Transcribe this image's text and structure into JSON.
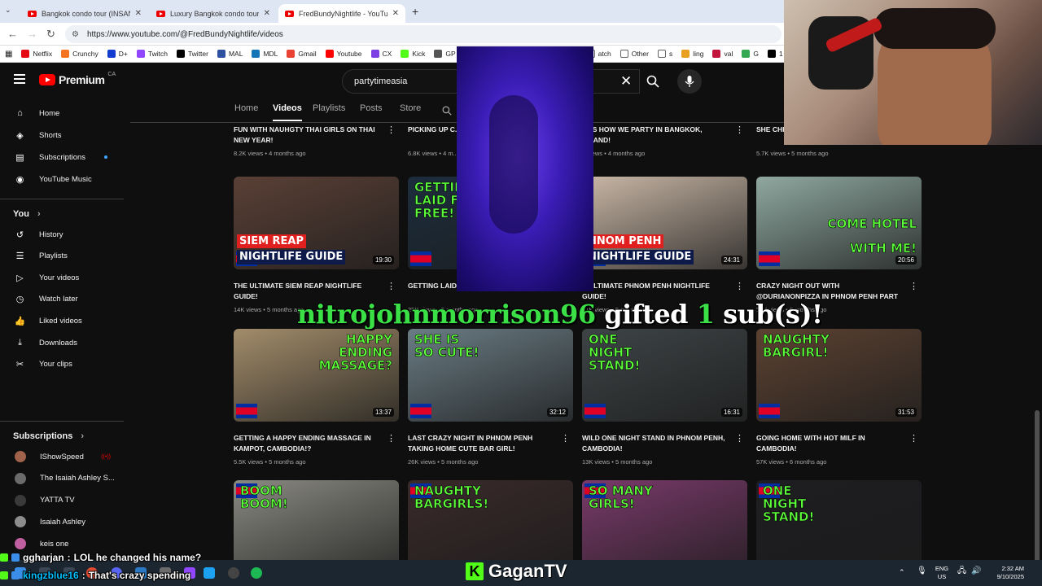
{
  "browser": {
    "tabs": [
      {
        "title": "Bangkok condo tour (INSANE v"
      },
      {
        "title": "Luxury Bangkok condo tour $5("
      },
      {
        "title": "FredBundyNightlife - YouTube"
      }
    ],
    "url": "https://www.youtube.com/@FredBundyNightlife/videos",
    "bookmarks": [
      {
        "label": "Netflix",
        "color": "#e50914"
      },
      {
        "label": "Crunchy",
        "color": "#f47521"
      },
      {
        "label": "D+",
        "color": "#113ccf"
      },
      {
        "label": "Twitch",
        "color": "#9146ff"
      },
      {
        "label": "Twitter",
        "color": "#000000"
      },
      {
        "label": "MAL",
        "color": "#2e51a2"
      },
      {
        "label": "MDL",
        "color": "#1675b6"
      },
      {
        "label": "Gmail",
        "color": "#ea4335"
      },
      {
        "label": "Youtube",
        "color": "#ff0000"
      },
      {
        "label": "CX",
        "color": "#7b3fe4"
      },
      {
        "label": "Kick",
        "color": "#53fc18"
      },
      {
        "label": "GP",
        "color": "#555555"
      }
    ],
    "bookmarks_right": [
      {
        "label": "atch",
        "color": "#ffffff"
      },
      {
        "label": "Other",
        "color": "#ffffff"
      },
      {
        "label": "s",
        "color": "#ffffff"
      },
      {
        "label": "ling",
        "color": "#e8a020"
      },
      {
        "label": "val",
        "color": "#c0143c"
      },
      {
        "label": "G",
        "color": "#34a853"
      },
      {
        "label": "1",
        "color": "#000000"
      }
    ]
  },
  "youtube": {
    "logo_text": "Premium",
    "logo_country": "CA",
    "search_value": "partytimeasia",
    "sidebar": {
      "main": [
        {
          "label": "Home",
          "icon": "home-icon"
        },
        {
          "label": "Shorts",
          "icon": "shorts-icon"
        },
        {
          "label": "Subscriptions",
          "icon": "subscriptions-icon"
        },
        {
          "label": "YouTube Music",
          "icon": "music-icon"
        }
      ],
      "you_heading": "You",
      "you": [
        {
          "label": "History",
          "icon": "history-icon"
        },
        {
          "label": "Playlists",
          "icon": "playlists-icon"
        },
        {
          "label": "Your videos",
          "icon": "your-videos-icon"
        },
        {
          "label": "Watch later",
          "icon": "clock-icon"
        },
        {
          "label": "Liked videos",
          "icon": "thumbs-up-icon"
        },
        {
          "label": "Downloads",
          "icon": "download-icon"
        },
        {
          "label": "Your clips",
          "icon": "scissors-icon"
        }
      ],
      "subs_heading": "Subscriptions",
      "subscriptions": [
        {
          "label": "IShowSpeed",
          "color": "#a0624a"
        },
        {
          "label": "The Isaiah Ashley S...",
          "color": "#6b6b6b"
        },
        {
          "label": "YATTA TV",
          "color": "#3a3a3a"
        },
        {
          "label": "Isaiah Ashley",
          "color": "#8d8d8d"
        },
        {
          "label": "keis one",
          "color": "#c060a0"
        },
        {
          "label": "C Engineer",
          "color": "#2c2c2c"
        },
        {
          "label": "Solo Mission",
          "color": "#4a6fa0"
        }
      ]
    },
    "channel_tabs": [
      "Home",
      "Videos",
      "Playlists",
      "Posts",
      "Store"
    ],
    "active_tab": "Videos",
    "rows": [
      [
        {
          "title": "FUN WITH NAUHGTY THAI GIRLS ON THAI NEW YEAR!",
          "views": "8.2K views",
          "age": "4 months ago"
        },
        {
          "title": "PICKING UP C... WALKING STR...",
          "views": "6.8K views",
          "age": "4 m..."
        },
        {
          "title": "IS IS HOW WE PARTY IN BANGKOK, AILAND!",
          "views": "...views",
          "age": "4 months ago"
        },
        {
          "title": "SHE CHI... TAKES M...",
          "views": "5.7K views",
          "age": "5 months ago"
        }
      ],
      [
        {
          "title": "THE ULTIMATE SIEM REAP NIGHTLIFE GUIDE!",
          "views": "14K views",
          "age": "5 months ago",
          "duration": "19:30",
          "overlay": [
            "SIEM REAP",
            "NIGHTLIFE GUIDE"
          ],
          "bg": "#5a4036"
        },
        {
          "title": "GETTING LAID... (CRAZY COLLAB PART 2)",
          "views": "25K views",
          "age": "5 months ago",
          "duration": "",
          "overlay": [
            "GETTIN",
            "LAID FO",
            "FREE!"
          ],
          "bg": "#1d2d3d"
        },
        {
          "title": "E ULTIMATE PHNOM PENH NIGHTLIFE GUIDE!",
          "views": "21K views",
          "age": "5 months ago",
          "duration": "24:31",
          "overlay": [
            "HNOM PENH",
            "NIGHTLIFE GUIDE"
          ],
          "bg": "#c9b7a6"
        },
        {
          "title": "CRAZY NIGHT OUT WITH @durianonpizza IN PHNOM PENH PART 1!",
          "views": "16K views",
          "age": "5 months ago",
          "duration": "20:56",
          "overlay": [
            "COME HOTEL",
            "WITH ME!"
          ],
          "bg": "#8fa8a0"
        }
      ],
      [
        {
          "title": "GETTING A HAPPY ENDING MASSAGE IN KAMPOT, CAMBODIA!?",
          "views": "5.5K views",
          "age": "5 months ago",
          "duration": "13:37",
          "overlay": [
            "HAPPY",
            "ENDING",
            "MASSAGE?"
          ],
          "bg": "#a28c6a"
        },
        {
          "title": "LAST CRAZY NIGHT IN PHNOM PENH TAKING HOME CUTE BAR GIRL!",
          "views": "26K views",
          "age": "5 months ago",
          "duration": "32:12",
          "overlay": [
            "SHE IS",
            "SO CUTE!"
          ],
          "bg": "#6a7c84"
        },
        {
          "title": "WILD ONE NIGHT STAND IN PHNOM PENH, CAMBODIA!",
          "views": "13K views",
          "age": "5 months ago",
          "duration": "16:31",
          "overlay": [
            "ONE",
            "NIGHT",
            "STAND!"
          ],
          "bg": "#3e4446"
        },
        {
          "title": "GOING HOME WITH HOT MILF IN CAMBODIA!",
          "views": "57K views",
          "age": "6 months ago",
          "duration": "31:53",
          "overlay": [
            "NAUGHTY",
            "BARGIRL!"
          ],
          "bg": "#5c4232"
        }
      ],
      [
        {
          "overlay": [
            "BOOM",
            "BOOM!"
          ],
          "bg": "#8a8a82"
        },
        {
          "overlay": [
            "NAUGHTY",
            "BARGIRLS!"
          ],
          "bg": "#3a2a2a"
        },
        {
          "overlay": [
            "SO MANY",
            "GIRLS!"
          ],
          "bg": "#7a3a6a"
        },
        {
          "overlay": [
            "ONE",
            "NIGHT",
            "STAND!"
          ],
          "bg": "#1e1e22"
        }
      ]
    ]
  },
  "stream": {
    "gift_user": "nitrojohnmorrison96",
    "gift_text_1": "gifted",
    "gift_count": "1",
    "gift_text_2": "sub(s)!",
    "chat": [
      {
        "user": "ggharjan",
        "message": "LOL he changed his name?"
      },
      {
        "user": "kingzblue16",
        "message": "That's crazy spending"
      }
    ],
    "brand": "GaganTV"
  },
  "taskbar": {
    "lang": "ENG",
    "region": "US",
    "time": "2:32 AM",
    "date": "9/10/2025"
  }
}
